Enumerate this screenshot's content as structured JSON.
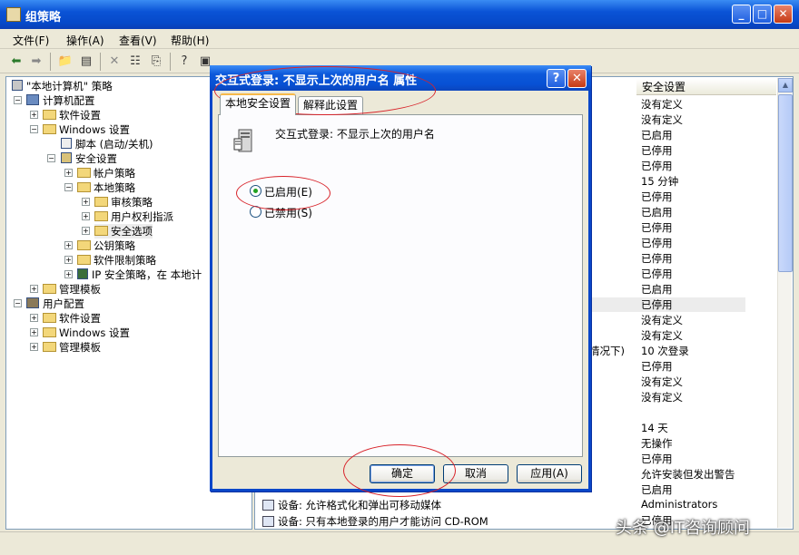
{
  "window": {
    "title": "组策略"
  },
  "menu": [
    "文件(F)",
    "操作(A)",
    "查看(V)",
    "帮助(H)"
  ],
  "tree": [
    {
      "label": "\"本地计算机\" 策略",
      "icon": "policy-icon"
    },
    {
      "label": "计算机配置",
      "icon": "computer-icon"
    },
    {
      "label": "软件设置",
      "icon": "folder-icon"
    },
    {
      "label": "Windows 设置",
      "icon": "folder-icon"
    },
    {
      "label": "脚本 (启动/关机)",
      "icon": "script-icon"
    },
    {
      "label": "安全设置",
      "icon": "security-icon"
    },
    {
      "label": "帐户策略",
      "icon": "folder-icon"
    },
    {
      "label": "本地策略",
      "icon": "folder-icon"
    },
    {
      "label": "审核策略",
      "icon": "folder-icon"
    },
    {
      "label": "用户权利指派",
      "icon": "folder-icon"
    },
    {
      "label": "安全选项",
      "icon": "folder-icon"
    },
    {
      "label": "公钥策略",
      "icon": "folder-icon"
    },
    {
      "label": "软件限制策略",
      "icon": "folder-icon"
    },
    {
      "label": "IP 安全策略，在 本地计",
      "icon": "ip-policy-icon"
    },
    {
      "label": "管理模板",
      "icon": "folder-icon"
    },
    {
      "label": "用户配置",
      "icon": "user-icon"
    },
    {
      "label": "软件设置",
      "icon": "folder-icon"
    },
    {
      "label": "Windows 设置",
      "icon": "folder-icon"
    },
    {
      "label": "管理模板",
      "icon": "folder-icon"
    }
  ],
  "list": {
    "column_header": "安全设置",
    "values": [
      "没有定义",
      "没有定义",
      "已启用",
      "已停用",
      "已停用",
      "15 分钟",
      "已停用",
      "已启用",
      "已停用",
      "已停用",
      "已停用",
      "已停用",
      "已启用",
      "已停用",
      "没有定义",
      "没有定义",
      "10 次登录",
      "已停用",
      "没有定义",
      "没有定义",
      "",
      "14 天",
      "无操作",
      "已停用",
      "允许安装但发出警告",
      "已启用",
      "Administrators",
      "已停用"
    ],
    "partial_text": "情况下)",
    "rows": [
      "设备: 允许格式化和弹出可移动媒体",
      "设备: 只有本地登录的用户才能访问 CD-ROM"
    ]
  },
  "dialog": {
    "title": "交互式登录: 不显示上次的用户名 属性",
    "tabs": [
      "本地安全设置",
      "解释此设置"
    ],
    "policy_name": "交互式登录: 不显示上次的用户名",
    "options": [
      "已启用(E)",
      "已禁用(S)"
    ],
    "selected": "已启用(E)",
    "buttons": {
      "ok": "确定",
      "cancel": "取消",
      "apply": "应用(A)"
    }
  },
  "watermark": "头条 @IT咨询顾问",
  "colors": {
    "titlebar": "#0a53d6",
    "highlight_oval": "#d8232a",
    "radio_dot": "#21a121"
  }
}
